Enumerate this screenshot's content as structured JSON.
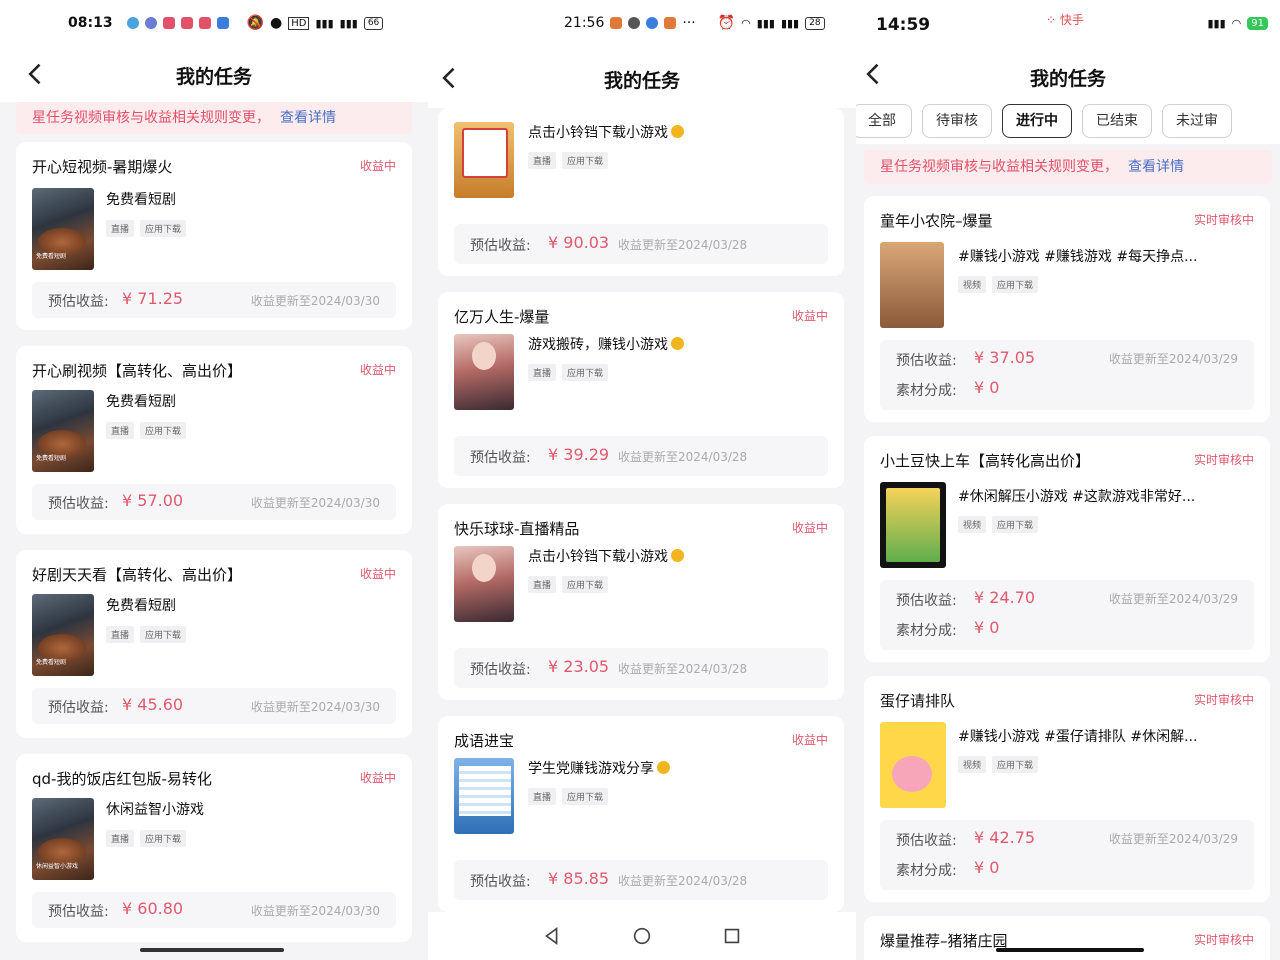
{
  "screen1": {
    "status": {
      "time": "08:13",
      "battery": "66"
    },
    "title": "我的任务",
    "notice": {
      "text": "星任务视频审核与收益相关规则变更，",
      "link": "查看详情"
    },
    "cards": [
      {
        "title": "开心短视频-暑期爆火",
        "status": "收益中",
        "task": "免费看短剧",
        "tags": [
          "直播",
          "应用下载"
        ],
        "earn_label": "预估收益:",
        "amount": "¥ 71.25",
        "update": "收益更新至2024/03/30",
        "thumb_caption": "免费看短剧"
      },
      {
        "title": "开心刷视频【高转化、高出价】",
        "status": "收益中",
        "task": "免费看短剧",
        "tags": [
          "直播",
          "应用下载"
        ],
        "earn_label": "预估收益:",
        "amount": "¥ 57.00",
        "update": "收益更新至2024/03/30",
        "thumb_caption": "免费看短剧"
      },
      {
        "title": "好剧天天看【高转化、高出价】",
        "status": "收益中",
        "task": "免费看短剧",
        "tags": [
          "直播",
          "应用下载"
        ],
        "earn_label": "预估收益:",
        "amount": "¥ 45.60",
        "update": "收益更新至2024/03/30",
        "thumb_caption": "免费看短剧"
      },
      {
        "title": "qd-我的饭店红包版-易转化",
        "status": "收益中",
        "task": "休闲益智小游戏",
        "tags": [
          "直播",
          "应用下载"
        ],
        "earn_label": "预估收益:",
        "amount": "¥ 60.80",
        "update": "收益更新至2024/03/30",
        "thumb_caption": "休闲益智小游戏"
      }
    ]
  },
  "screen2": {
    "status": {
      "time": "21:56",
      "battery": "28"
    },
    "title": "我的任务",
    "cards": [
      {
        "title": "",
        "status": "",
        "task": "点击小铃铛下载小游戏",
        "tags": [
          "直播",
          "应用下载"
        ],
        "earn_label": "预估收益:",
        "amount": "¥ 90.03",
        "update": "收益更新至2024/03/28"
      },
      {
        "title": "亿万人生-爆量",
        "status": "收益中",
        "task": "游戏搬砖，赚钱小游戏",
        "tags": [
          "直播",
          "应用下载"
        ],
        "earn_label": "预估收益:",
        "amount": "¥ 39.29",
        "update": "收益更新至2024/03/28"
      },
      {
        "title": "快乐球球-直播精品",
        "status": "收益中",
        "task": "点击小铃铛下载小游戏",
        "tags": [
          "直播",
          "应用下载"
        ],
        "earn_label": "预估收益:",
        "amount": "¥ 23.05",
        "update": "收益更新至2024/03/28"
      },
      {
        "title": "成语进宝",
        "status": "收益中",
        "task": "学生党赚钱游戏分享",
        "tags": [
          "直播",
          "应用下载"
        ],
        "earn_label": "预估收益:",
        "amount": "¥ 85.85",
        "update": "收益更新至2024/03/28"
      }
    ]
  },
  "screen3": {
    "status": {
      "time": "14:59",
      "app": "快手",
      "battery": "91"
    },
    "title": "我的任务",
    "filters": [
      "全部",
      "待审核",
      "进行中",
      "已结束",
      "未过审"
    ],
    "active_filter": "进行中",
    "notice": {
      "text": "星任务视频审核与收益相关规则变更，",
      "link": "查看详情"
    },
    "cards": [
      {
        "title": "童年小农院–爆量",
        "status": "实时审核中",
        "task": "#赚钱小游戏 #赚钱游戏 #每天挣点...",
        "tags": [
          "视频",
          "应用下载"
        ],
        "earn_label": "预估收益:",
        "amount": "¥ 37.05",
        "update": "收益更新至2024/03/29",
        "share_label": "素材分成:",
        "share": "¥ 0"
      },
      {
        "title": "小土豆快上车【高转化高出价】",
        "status": "实时审核中",
        "task": "#休闲解压小游戏 #这款游戏非常好...",
        "tags": [
          "视频",
          "应用下载"
        ],
        "earn_label": "预估收益:",
        "amount": "¥ 24.70",
        "update": "收益更新至2024/03/29",
        "share_label": "素材分成:",
        "share": "¥ 0"
      },
      {
        "title": "蛋仔请排队",
        "status": "实时审核中",
        "task": "#赚钱小游戏 #蛋仔请排队 #休闲解...",
        "tags": [
          "视频",
          "应用下载"
        ],
        "earn_label": "预估收益:",
        "amount": "¥ 42.75",
        "update": "收益更新至2024/03/29",
        "share_label": "素材分成:",
        "share": "¥ 0"
      },
      {
        "title": "爆量推荐–猪猪庄园",
        "status": "实时审核中"
      }
    ]
  }
}
